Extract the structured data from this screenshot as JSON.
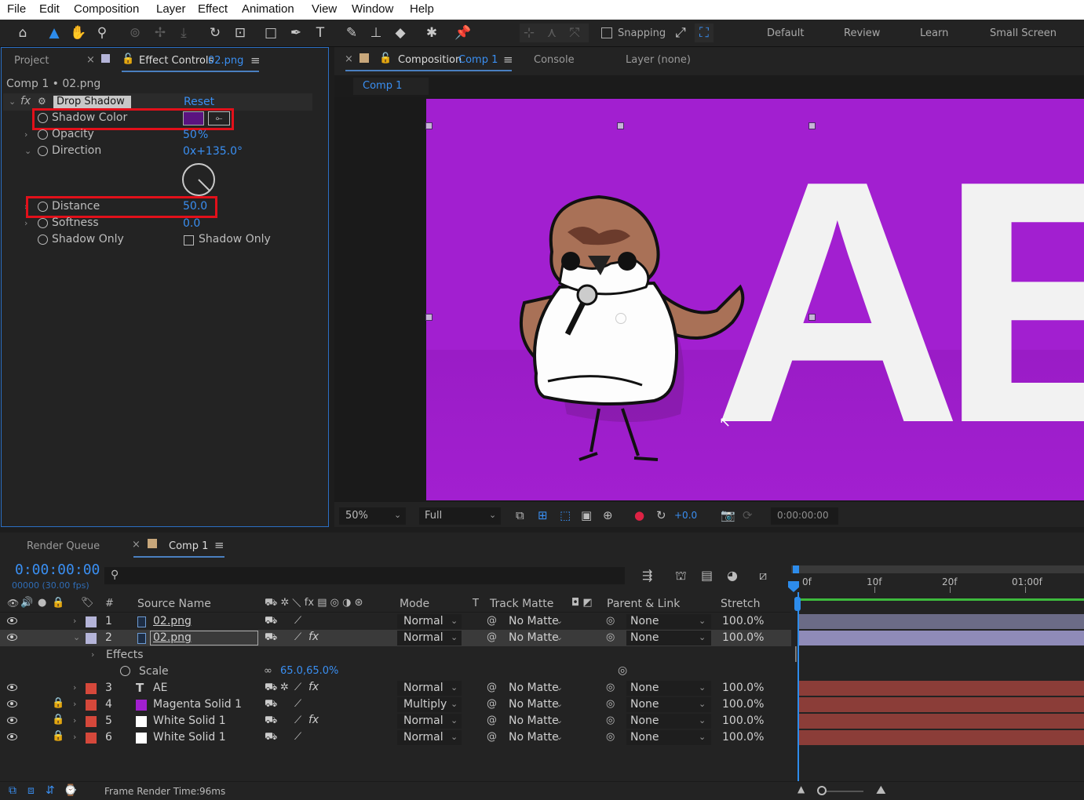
{
  "menu": [
    "File",
    "Edit",
    "Composition",
    "Layer",
    "Effect",
    "Animation",
    "View",
    "Window",
    "Help"
  ],
  "toolbar": {
    "snapping_label": "Snapping",
    "workspaces": [
      "Default",
      "Review",
      "Learn",
      "Small Screen"
    ]
  },
  "left_panel": {
    "tab_project": "Project",
    "tab_effect_controls": "Effect Controls",
    "tab_effect_controls_file": "02.png",
    "breadcrumb": "Comp 1 • 02.png",
    "effect_name": "Drop Shadow",
    "reset_label": "Reset",
    "properties": {
      "shadow_color_label": "Shadow Color",
      "shadow_color_value": "#5a1380",
      "opacity_label": "Opacity",
      "opacity_value": "50",
      "opacity_unit": "%",
      "direction_label": "Direction",
      "direction_value": "0x+135.0°",
      "distance_label": "Distance",
      "distance_value": "50.0",
      "softness_label": "Softness",
      "softness_value": "0.0",
      "shadow_only_label": "Shadow Only",
      "shadow_only_checkbox_label": "Shadow Only"
    }
  },
  "comp_panel": {
    "tab_composition": "Composition",
    "tab_comp_name": "Comp 1",
    "tab_console": "Console",
    "tab_layer": "Layer (none)",
    "sub_tab": "Comp 1",
    "canvas_text": "AE",
    "canvas_color": "#a21fd0",
    "zoom": "50%",
    "resolution": "Full",
    "exposure": "+0.0",
    "timecode": "0:00:00:00"
  },
  "timeline": {
    "tab_render_queue": "Render Queue",
    "tab_comp": "Comp 1",
    "current_time": "0:00:00:00",
    "frame_info": "00000 (30.00 fps)",
    "columns": {
      "number": "#",
      "source_name": "Source Name",
      "mode": "Mode",
      "t": "T",
      "track_matte": "Track Matte",
      "parent_link": "Parent & Link",
      "stretch": "Stretch"
    },
    "ruler": [
      "0f",
      "10f",
      "20f",
      "01:00f"
    ],
    "layers": [
      {
        "num": "1",
        "name": "02.png",
        "mode": "Normal",
        "matte": "No Matte",
        "parent": "None",
        "stretch": "100.0%",
        "label_color": "#b4b4d8",
        "icon": "footage-icon",
        "fx": false,
        "locked": false
      },
      {
        "num": "2",
        "name": "02.png",
        "mode": "Normal",
        "matte": "No Matte",
        "parent": "None",
        "stretch": "100.0%",
        "label_color": "#b4b4d8",
        "icon": "footage-icon",
        "fx": true,
        "locked": false
      },
      {
        "num": "3",
        "name": "AE",
        "mode": "Normal",
        "matte": "No Matte",
        "parent": "None",
        "stretch": "100.0%",
        "label_color": "#d5483b",
        "icon": "text-icon",
        "fx": true,
        "locked": false
      },
      {
        "num": "4",
        "name": "Magenta Solid 1",
        "mode": "Multiply",
        "matte": "No Matte",
        "parent": "None",
        "stretch": "100.0%",
        "label_color": "#d5483b",
        "icon": "solid-magenta",
        "fx": false,
        "locked": true
      },
      {
        "num": "5",
        "name": "White Solid 1",
        "mode": "Normal",
        "matte": "No Matte",
        "parent": "None",
        "stretch": "100.0%",
        "label_color": "#d5483b",
        "icon": "solid-white",
        "fx": true,
        "locked": true
      },
      {
        "num": "6",
        "name": "White Solid 1",
        "mode": "Normal",
        "matte": "No Matte",
        "parent": "None",
        "stretch": "100.0%",
        "label_color": "#d5483b",
        "icon": "solid-white",
        "fx": false,
        "locked": true
      }
    ],
    "effects_label": "Effects",
    "scale_label": "Scale",
    "scale_value": "65.0,65.0%",
    "frame_render_label": "Frame Render Time:",
    "frame_render_value": "96ms"
  }
}
